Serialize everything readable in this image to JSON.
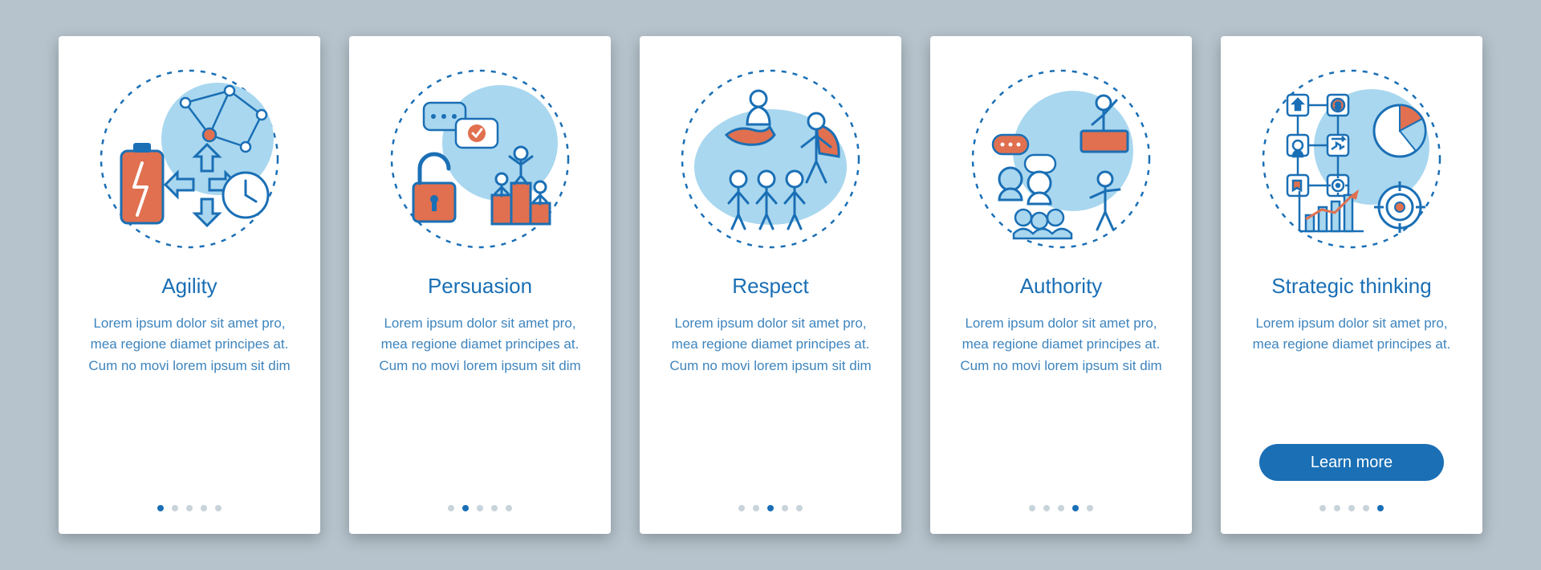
{
  "colors": {
    "background": "#b6c3cc",
    "card": "#ffffff",
    "primary": "#1a6fb5",
    "text": "#3d84bd",
    "accent": "#e0704f",
    "lightBlue": "#a9d7ef",
    "dotInactive": "#c8d3da"
  },
  "screens": [
    {
      "icon": "agility-icon",
      "title": "Agility",
      "body": "Lorem ipsum dolor sit amet pro, mea regione diamet principes at. Cum no movi lorem ipsum sit dim",
      "activeDot": 0,
      "totalDots": 5,
      "button": null
    },
    {
      "icon": "persuasion-icon",
      "title": "Persuasion",
      "body": "Lorem ipsum dolor sit amet pro, mea regione diamet principes at. Cum no movi lorem ipsum sit dim",
      "activeDot": 1,
      "totalDots": 5,
      "button": null
    },
    {
      "icon": "respect-icon",
      "title": "Respect",
      "body": "Lorem ipsum dolor sit amet pro, mea regione diamet principes at. Cum no movi lorem ipsum sit dim",
      "activeDot": 2,
      "totalDots": 5,
      "button": null
    },
    {
      "icon": "authority-icon",
      "title": "Authority",
      "body": "Lorem ipsum dolor sit amet pro, mea regione diamet principes at. Cum no movi lorem ipsum sit dim",
      "activeDot": 3,
      "totalDots": 5,
      "button": null
    },
    {
      "icon": "strategic-thinking-icon",
      "title": "Strategic thinking",
      "body": "Lorem ipsum dolor sit amet pro, mea regione diamet principes at.",
      "activeDot": 4,
      "totalDots": 5,
      "button": "Learn more"
    }
  ]
}
